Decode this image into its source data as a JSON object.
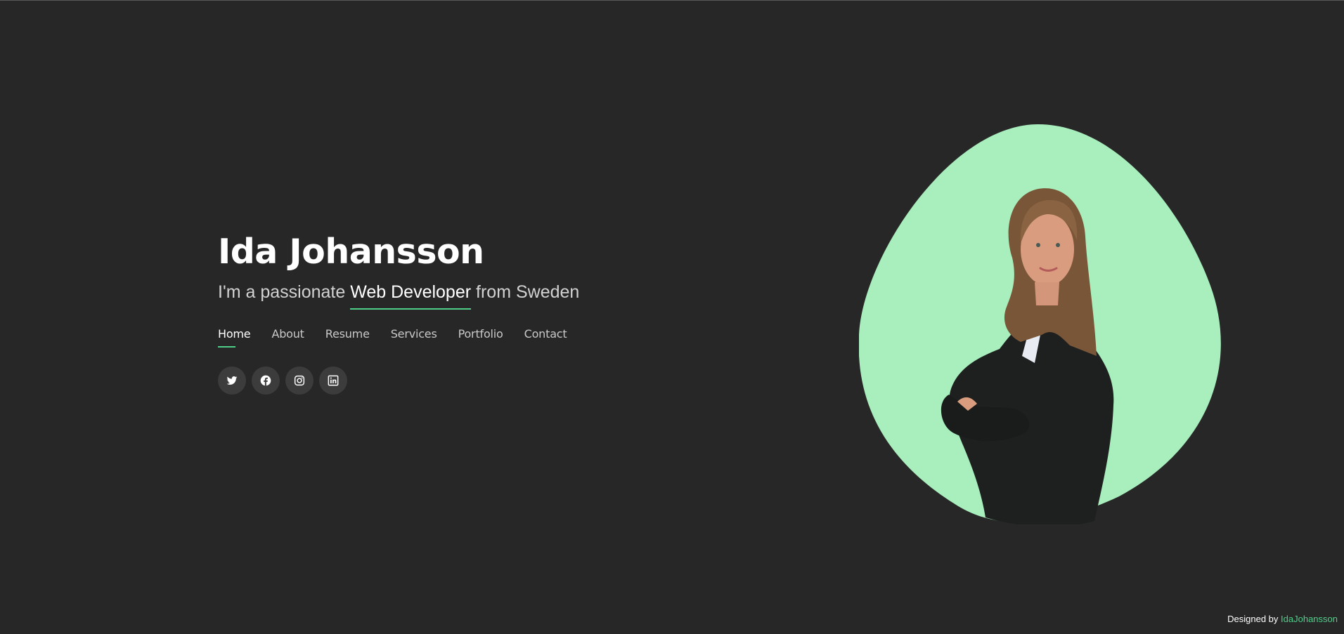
{
  "header": {
    "name": "Ida Johansson",
    "tagline_prefix": "I'm a passionate",
    "tagline_role": "Web Developer",
    "tagline_suffix": "from Sweden"
  },
  "nav": {
    "items": [
      {
        "label": "Home",
        "active": true
      },
      {
        "label": "About",
        "active": false
      },
      {
        "label": "Resume",
        "active": false
      },
      {
        "label": "Services",
        "active": false
      },
      {
        "label": "Portfolio",
        "active": false
      },
      {
        "label": "Contact",
        "active": false
      }
    ]
  },
  "social": {
    "icons": [
      "twitter-icon",
      "facebook-icon",
      "instagram-icon",
      "linkedin-icon"
    ]
  },
  "footer": {
    "credit_prefix": "Designed by",
    "credit_name": "IdaJohansson"
  },
  "colors": {
    "background": "#272727",
    "accent": "#4fce8a",
    "blob": "#a8efbd",
    "icon_button": "#3c3c3c",
    "text_muted": "#c9c9c9"
  }
}
